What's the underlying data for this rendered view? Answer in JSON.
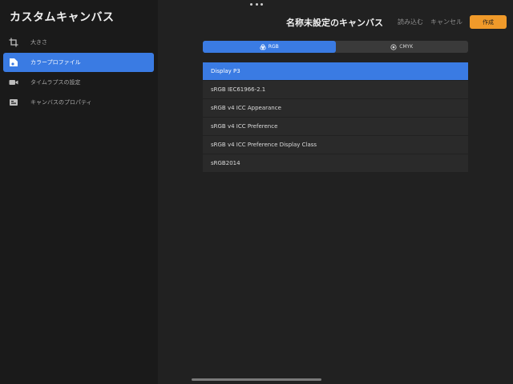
{
  "app": {
    "title": "カスタムキャンバス"
  },
  "sidebar": {
    "items": [
      {
        "label": "大きさ",
        "icon": "crop-icon",
        "active": false
      },
      {
        "label": "カラープロファイル",
        "icon": "color-profile-icon",
        "active": true
      },
      {
        "label": "タイムラプスの設定",
        "icon": "video-camera-icon",
        "active": false
      },
      {
        "label": "キャンバスのプロパティ",
        "icon": "canvas-properties-icon",
        "active": false
      }
    ]
  },
  "header": {
    "title": "名称未設定のキャンバス",
    "import_label": "読み込む",
    "cancel_label": "キャンセル",
    "create_label": "作成"
  },
  "color_mode": {
    "options": [
      {
        "label": "RGB",
        "icon": "rgb-circles-icon",
        "active": true
      },
      {
        "label": "CMYK",
        "icon": "cmyk-circles-icon",
        "active": false
      }
    ]
  },
  "profiles": {
    "items": [
      "Display P3",
      "sRGB IEC61966-2.1",
      "sRGB v4 ICC Appearance",
      "sRGB v4 ICC Preference",
      "sRGB v4 ICC Preference Display Class",
      "sRGB2014"
    ],
    "selected": "Display P3"
  },
  "colors": {
    "accent": "#3a7be3",
    "create_button": "#f09a2a",
    "background": "#1e1e1e"
  }
}
